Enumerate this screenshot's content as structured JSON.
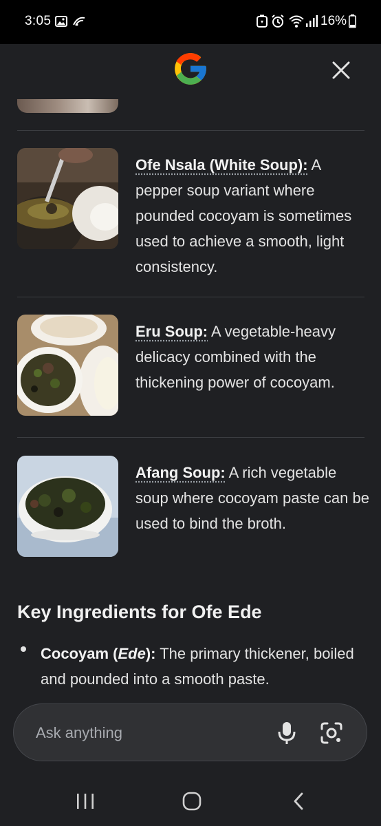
{
  "status_bar": {
    "time": "3:05",
    "battery_percent": "16%",
    "icons": [
      "image-icon",
      "cast-icon",
      "battery-saver-icon",
      "alarm-icon",
      "wifi-icon",
      "signal-icon",
      "battery-icon"
    ]
  },
  "header": {
    "logo": "google-g-logo",
    "close_icon": "close-icon"
  },
  "content": {
    "items": [
      {
        "title": "Ofe Nsala (White Soup):",
        "description": " A pepper soup variant where pounded cocoyam is sometimes used to achieve a smooth, light consistency."
      },
      {
        "title": "Eru Soup:",
        "description": " A vegetable-heavy delicacy combined with the thickening power of cocoyam."
      },
      {
        "title": "Afang Soup:",
        "description": " A rich vegetable soup where cocoyam paste can be used to bind the broth."
      }
    ],
    "section_title": "Key Ingredients for Ofe Ede",
    "bullets": [
      {
        "bold_prefix": "Cocoyam (",
        "bold_italic": "Ede",
        "bold_suffix": "):",
        "text": " The primary thickener, boiled and pounded into a smooth paste."
      }
    ]
  },
  "ask_bar": {
    "placeholder": "Ask anything",
    "mic_icon": "microphone-icon",
    "lens_icon": "lens-icon"
  },
  "nav_bar": {
    "icons": [
      "recent-apps-icon",
      "home-icon",
      "back-icon"
    ]
  },
  "colors": {
    "background": "#1f2023",
    "status_bar": "#000000",
    "text": "#e3e3e3",
    "divider": "#3c3e42",
    "ask_bar": "#303134"
  }
}
